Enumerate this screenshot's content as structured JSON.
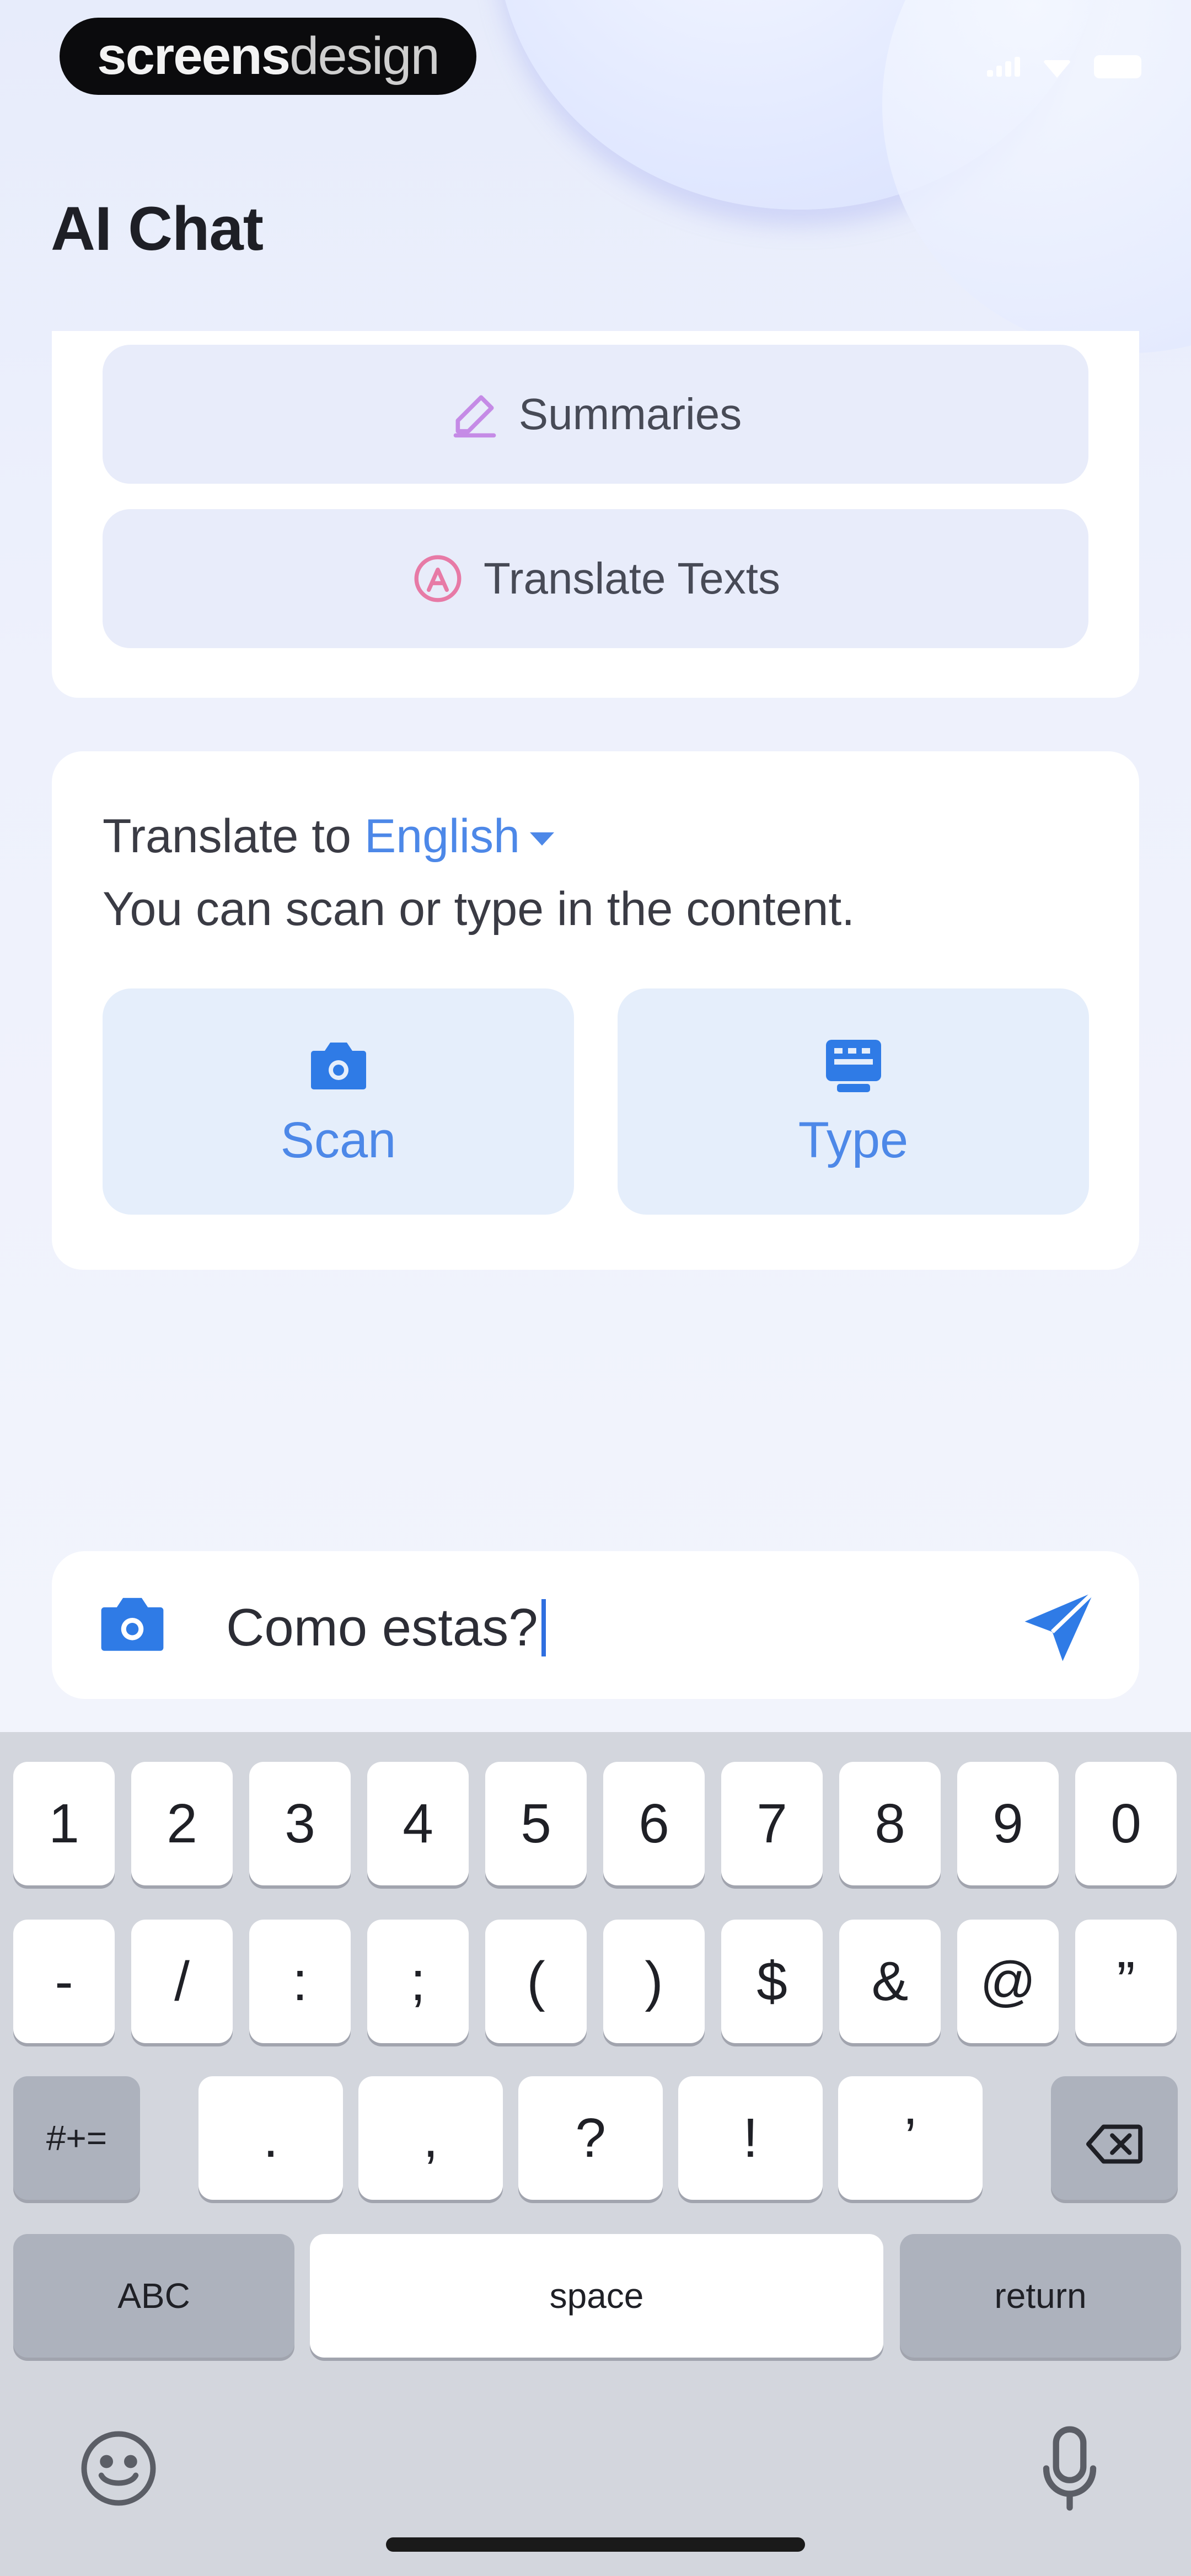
{
  "status_bar": {
    "brand_bold": "screens",
    "brand_light": "design"
  },
  "header": {
    "title": "AI Chat"
  },
  "options": [
    {
      "label": "Summaries",
      "icon": "pen-icon"
    },
    {
      "label": "Translate Texts",
      "icon": "translate-icon"
    }
  ],
  "translate_card": {
    "prefix": "Translate to",
    "language": "English",
    "hint": "You can scan or type in the content.",
    "actions": [
      {
        "label": "Scan",
        "icon": "camera-icon"
      },
      {
        "label": "Type",
        "icon": "keyboard-icon"
      }
    ]
  },
  "input": {
    "value": "Como estas?",
    "camera_icon": "camera-icon",
    "send_icon": "send-icon"
  },
  "keyboard": {
    "row1": [
      "1",
      "2",
      "3",
      "4",
      "5",
      "6",
      "7",
      "8",
      "9",
      "0"
    ],
    "row2": [
      "-",
      "/",
      ":",
      ";",
      "(",
      ")",
      "$",
      "&",
      "@",
      "”"
    ],
    "row3": [
      "#+=",
      ".",
      ",",
      "?",
      "!",
      "’"
    ],
    "abc": "ABC",
    "space": "space",
    "return": "return"
  },
  "colors": {
    "accent": "#4d88e8",
    "card_bg": "#ffffff",
    "option_bg": "#e8ecfa",
    "action_bg": "#e5eefb",
    "keyboard_bg": "#d3d6dd"
  }
}
